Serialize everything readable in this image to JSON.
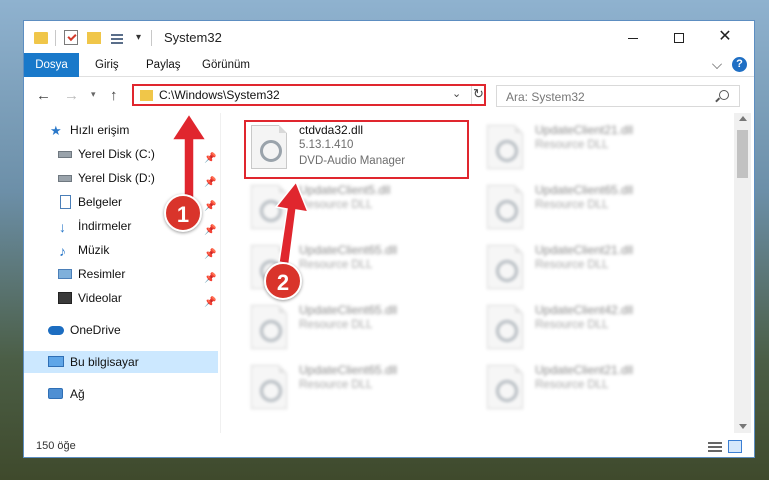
{
  "window": {
    "title": "System32"
  },
  "ribbon": {
    "tabs": [
      "Dosya",
      "Giriş",
      "Paylaş",
      "Görünüm"
    ]
  },
  "address": {
    "path": "C:\\Windows\\System32",
    "search_placeholder": "Ara: System32"
  },
  "sidebar": {
    "items": [
      {
        "label": "Hızlı erişim",
        "icon": "star-icon",
        "pinned": false
      },
      {
        "label": "Yerel Disk (C:)",
        "icon": "drive-icon",
        "pinned": true
      },
      {
        "label": "Yerel Disk (D:)",
        "icon": "drive-icon",
        "pinned": true
      },
      {
        "label": "Belgeler",
        "icon": "documents-icon",
        "pinned": true
      },
      {
        "label": "İndirmeler",
        "icon": "download-icon",
        "pinned": true
      },
      {
        "label": "Müzik",
        "icon": "music-icon",
        "pinned": true
      },
      {
        "label": "Resimler",
        "icon": "pictures-icon",
        "pinned": true
      },
      {
        "label": "Videolar",
        "icon": "videos-icon",
        "pinned": true
      },
      {
        "label": "OneDrive",
        "icon": "cloud-icon",
        "pinned": false
      },
      {
        "label": "Bu bilgisayar",
        "icon": "computer-icon",
        "pinned": false,
        "selected": true
      },
      {
        "label": "Ağ",
        "icon": "network-icon",
        "pinned": false
      }
    ]
  },
  "files": [
    {
      "name": "ctdvda32.dll",
      "line1": "5.13.1.410",
      "line2": "DVD-Audio Manager",
      "blurred": false
    },
    {
      "name": "UpdateClient21.dll",
      "line1": "Resource DLL",
      "line2": "",
      "blurred": true
    },
    {
      "name": "UpdateClient5.dll",
      "line1": "Resource DLL",
      "line2": "",
      "blurred": true
    },
    {
      "name": "UpdateClient65.dll",
      "line1": "Resource DLL",
      "line2": "",
      "blurred": true
    },
    {
      "name": "UpdateClient65.dll",
      "line1": "Resource DLL",
      "line2": "",
      "blurred": true
    },
    {
      "name": "UpdateClient21.dll",
      "line1": "Resource DLL",
      "line2": "",
      "blurred": true
    },
    {
      "name": "UpdateClient65.dll",
      "line1": "Resource DLL",
      "line2": "",
      "blurred": true
    },
    {
      "name": "UpdateClient42.dll",
      "line1": "Resource DLL",
      "line2": "",
      "blurred": true
    },
    {
      "name": "UpdateClient65.dll",
      "line1": "Resource DLL",
      "line2": "",
      "blurred": true
    },
    {
      "name": "UpdateClient21.dll",
      "line1": "Resource DLL",
      "line2": "",
      "blurred": true
    }
  ],
  "status": {
    "item_count": "150 öğe"
  },
  "annotations": {
    "badge1": "1",
    "badge2": "2"
  },
  "colors": {
    "accent": "#1979ca",
    "highlight": "#e0262e",
    "badge": "#d9342b"
  }
}
